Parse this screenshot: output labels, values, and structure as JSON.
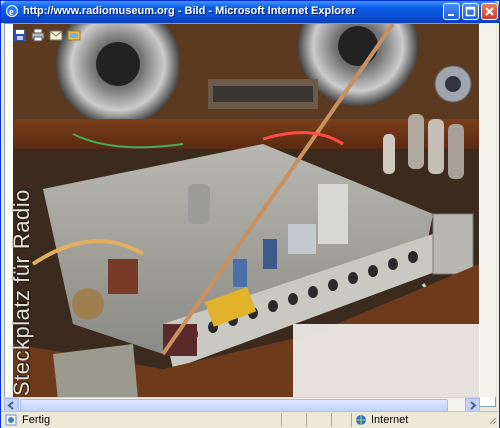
{
  "window": {
    "title": "http://www.radiomuseum.org - Bild - Microsoft Internet Explorer",
    "icons": [
      "ie-icon",
      "minimize-icon",
      "maximize-icon",
      "close-icon"
    ]
  },
  "image_toolbar": {
    "icons": [
      "save-icon",
      "print-icon",
      "email-icon",
      "my-pictures-icon"
    ]
  },
  "image": {
    "subject": "vintage radio chassis with tubes and speakers",
    "watermark": "Steckplatz für Radio"
  },
  "status": {
    "left_text": "Fertig",
    "zone_text": "Internet"
  },
  "colors": {
    "titlebar": "#0a5ce8",
    "close": "#c9402a",
    "frame": "#ece9d8"
  }
}
